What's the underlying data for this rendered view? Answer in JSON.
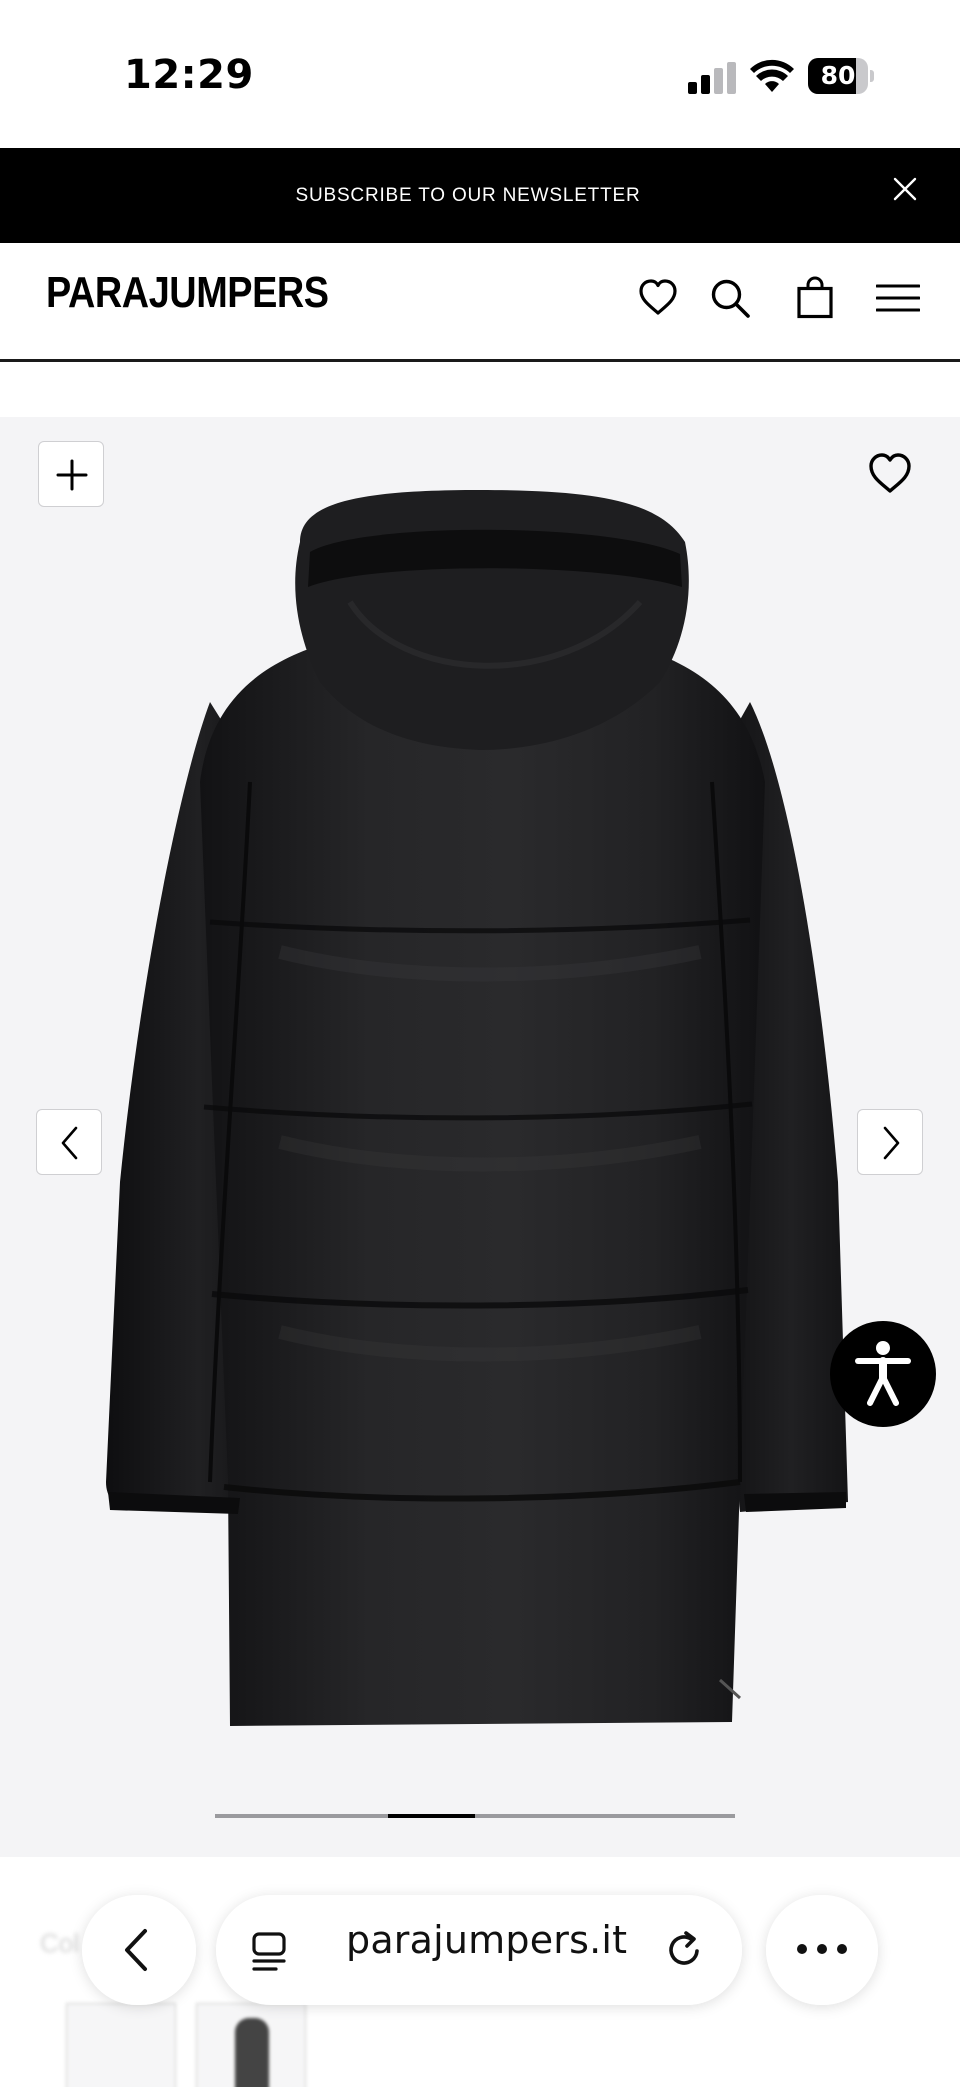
{
  "status_bar": {
    "time": "12:29",
    "signal_bars_active": 2,
    "signal_bars_total": 4,
    "battery_percent": 80,
    "battery_label": "80"
  },
  "newsletter": {
    "text": "SUBSCRIBE TO OUR NEWSLETTER",
    "close_icon": "close-icon"
  },
  "header": {
    "logo": "PARAJUMPERS",
    "icons": [
      "heart-icon",
      "search-icon",
      "shopping-bag-icon",
      "menu-icon"
    ]
  },
  "gallery": {
    "product_image": "black long hooded down parka, back view",
    "zoom_icon": "plus-icon",
    "wishlist_icon": "heart-icon",
    "prev_icon": "chevron-left-icon",
    "next_icon": "chevron-right-icon",
    "accessibility_icon": "accessibility-icon",
    "slide_index": 3,
    "slide_count": 6
  },
  "below": {
    "color_label": "Col"
  },
  "browser": {
    "url": "parajumpers.it",
    "back_icon": "chevron-left-icon",
    "tabs_icon": "tabs-icon",
    "reload_icon": "reload-icon",
    "more_icon": "more-icon"
  },
  "colors": {
    "banner": "#000000",
    "gallery_bg": "#f4f4f6",
    "jacket": "#1c1c1e"
  }
}
